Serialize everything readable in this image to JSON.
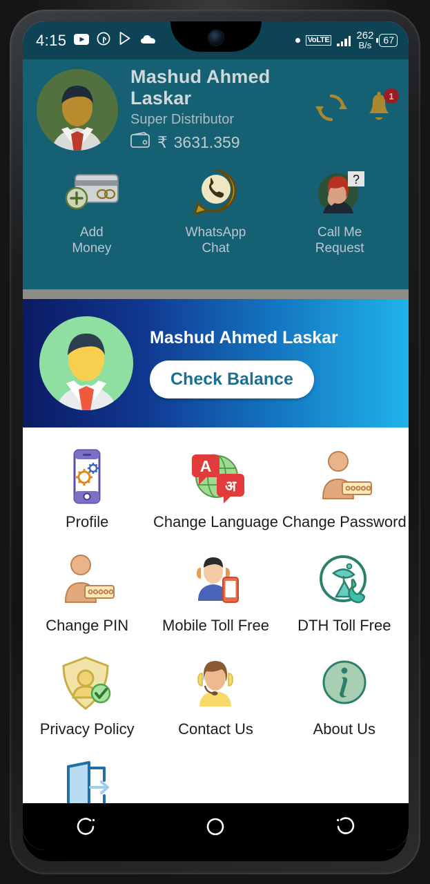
{
  "statusbar": {
    "time": "4:15",
    "icons_left": [
      "youtube-icon",
      "cast-icon",
      "play-store-icon",
      "cloud-icon"
    ],
    "dot": "notification-dot",
    "network_type": "VoLTE",
    "data_speed_value": "262",
    "data_speed_unit": "B/s",
    "battery_level": "67"
  },
  "header": {
    "user_name": "Mashud Ahmed Laskar",
    "role": "Super Distributor",
    "currency_symbol": "₹",
    "balance": "3631.359",
    "refresh_icon": "refresh-icon",
    "bell_icon": "bell-icon",
    "bell_badge": "1",
    "quick_actions": [
      {
        "label_line1": "Add",
        "label_line2": "Money",
        "icon": "add-money-icon"
      },
      {
        "label_line1": "WhatsApp",
        "label_line2": "Chat",
        "icon": "whatsapp-chat-icon"
      },
      {
        "label_line1": "Call Me",
        "label_line2": "Request",
        "icon": "call-me-request-icon"
      }
    ]
  },
  "banner": {
    "user_name": "Mashud Ahmed Laskar",
    "check_balance_label": "Check Balance",
    "gradient_start": "#0b1b63",
    "gradient_end": "#1fb3e8"
  },
  "menu": {
    "rows": [
      [
        {
          "label": "Profile",
          "icon": "profile-settings-icon"
        },
        {
          "label": "Change Language",
          "icon": "change-language-icon"
        },
        {
          "label": "Change Password",
          "icon": "change-password-icon"
        }
      ],
      [
        {
          "label": "Change PIN",
          "icon": "change-pin-icon"
        },
        {
          "label": "Mobile Toll Free",
          "icon": "mobile-toll-free-icon"
        },
        {
          "label": "DTH Toll Free",
          "icon": "dth-toll-free-icon"
        }
      ],
      [
        {
          "label": "Privacy Policy",
          "icon": "privacy-policy-icon"
        },
        {
          "label": "Contact Us",
          "icon": "contact-us-icon"
        },
        {
          "label": "About Us",
          "icon": "about-us-icon"
        }
      ],
      [
        {
          "label": "",
          "icon": "logout-icon"
        }
      ]
    ]
  },
  "navbar": {
    "recents_label": "recent-apps",
    "home_label": "home",
    "back_label": "back"
  },
  "colors": {
    "header_teal": "#166073",
    "statusbar_teal": "#0d4354",
    "accent_blue": "#1b6f91",
    "badge_red": "#9b1d23"
  }
}
